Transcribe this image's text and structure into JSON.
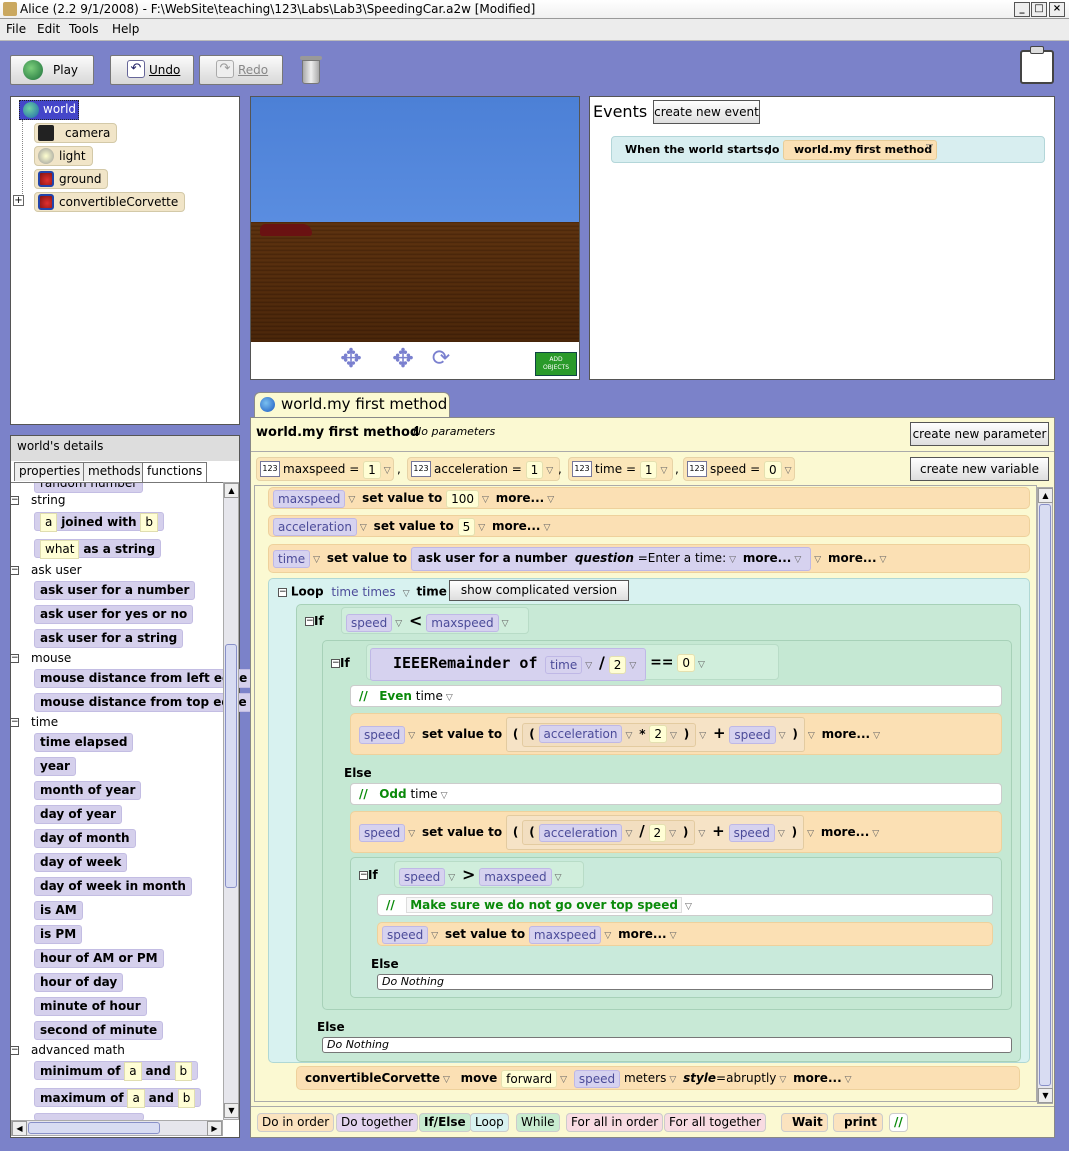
{
  "window": {
    "title": "Alice (2.2  9/1/2008) - F:\\WebSite\\teaching\\123\\Labs\\Lab3\\SpeedingCar.a2w [Modified]"
  },
  "menu": [
    "File",
    "Edit",
    "Tools",
    "Help"
  ],
  "toolbar": {
    "play": "Play",
    "undo": "Undo",
    "redo": "Redo"
  },
  "tree": {
    "items": [
      "world",
      "camera",
      "light",
      "ground",
      "convertibleCorvette"
    ]
  },
  "details": {
    "title": "world's details",
    "tabs": [
      "properties",
      "methods",
      "functions"
    ],
    "partial_top": "random number",
    "categories": {
      "string": "string",
      "askuser": "ask user",
      "mouse": "mouse",
      "time": "time",
      "math": "advanced math"
    },
    "string_fns": {
      "joined_a": "a",
      "joined_mid": "joined with",
      "joined_b": "b",
      "what": "what",
      "as_string": "as a string"
    },
    "askuser_fns": [
      "ask user for a number",
      "ask user for yes or no",
      "ask user for a string"
    ],
    "mouse_fns": [
      "mouse distance from left edge",
      "mouse distance from top edge"
    ],
    "time_fns": [
      "time elapsed",
      "year",
      "month of year",
      "day of year",
      "day of month",
      "day of week",
      "day of week in month",
      "is AM",
      "is PM",
      "hour of AM or PM",
      "hour of day",
      "minute of hour",
      "second of minute"
    ],
    "math_fns": {
      "min": "minimum of",
      "max": "maximum of",
      "a": "a",
      "and": "and",
      "b": "b"
    }
  },
  "scene": {
    "add_objects": "ADD OBJECTS"
  },
  "events": {
    "label": "Events",
    "create_button": "create new event",
    "when_text": "When the world starts ,",
    "do_text": "do",
    "method": "world.my first method"
  },
  "editor": {
    "tab": "world.my first method",
    "header_title": "world.my first method",
    "header_params": "No parameters",
    "create_param": "create new parameter",
    "create_var": "create new variable",
    "vars": [
      {
        "name": "maxspeed",
        "val": "1"
      },
      {
        "name": "acceleration",
        "val": "1"
      },
      {
        "name": "time",
        "val": "1"
      },
      {
        "name": "speed",
        "val": "0"
      }
    ],
    "n123": "123",
    "eq": "=",
    "set_value_to": "set value to",
    "more": "more...",
    "l1_var": "maxspeed",
    "l1_val": "100",
    "l2_var": "acceleration",
    "l2_val": "5",
    "l3_var": "time",
    "l3_ask": "ask user for a number",
    "l3_q": "question",
    "l3_qv": "Enter a time:",
    "loop": "Loop",
    "loop_times": "time times",
    "loop_time": "time",
    "show_complicated": "show complicated version",
    "if": "If",
    "speed": "speed",
    "maxspeed": "maxspeed",
    "acceleration": "acceleration",
    "time": "time",
    "lt": "<",
    "gt": ">",
    "div": "/",
    "mul": "*",
    "plus": "+",
    "eqeq": "==",
    "ieee": "IEEERemainder of",
    "two": "2",
    "zero": "0",
    "lp": "(",
    "rp": ")",
    "cmt_slash": "//",
    "even": "Even",
    "odd": "Odd",
    "over": "Make sure we do not go over top speed",
    "else": "Else",
    "do_nothing": "Do Nothing",
    "last_obj": "convertibleCorvette",
    "move": "move",
    "forward": "forward",
    "meters": "meters",
    "style": "style",
    "abruptly": "abruptly"
  },
  "controls": [
    "Do in order",
    "Do together",
    "If/Else",
    "Loop",
    "While",
    "For all in order",
    "For all together",
    "Wait",
    "print",
    "//"
  ]
}
